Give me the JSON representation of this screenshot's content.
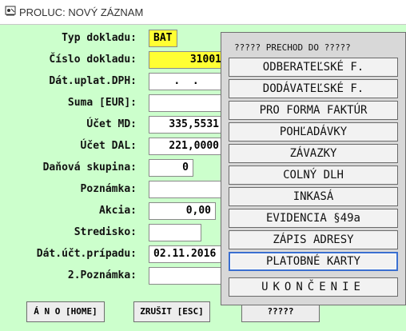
{
  "window": {
    "title": "PROLUC: NOVÝ ZÁZNAM"
  },
  "form": {
    "typ_dokladu": {
      "label": "Typ dokladu:",
      "value": "BAT"
    },
    "cislo_dokladu": {
      "label": "Číslo dokladu:",
      "value": "31001"
    },
    "dat_uplat_dph": {
      "label": "Dát.uplat.DPH:",
      "value": ".  ."
    },
    "suma": {
      "label": "Suma [EUR]:",
      "value": ""
    },
    "ucet_md": {
      "label": "Účet MD:",
      "value": "335,5531"
    },
    "ucet_dal": {
      "label": "Účet DAL:",
      "value": "221,0000"
    },
    "danova_skupina": {
      "label": "Daňová skupina:",
      "value": "0"
    },
    "poznamka": {
      "label": "Poznámka:",
      "value": ""
    },
    "akcia": {
      "label": "Akcia:",
      "value": "0,00"
    },
    "stredisko": {
      "label": "Stredisko:",
      "value": ""
    },
    "dat_uct_pripadu": {
      "label": "Dát.účt.prípadu:",
      "value": "02.11.2016"
    },
    "poznamka2": {
      "label": "2.Poznámka:",
      "value": ""
    }
  },
  "buttons": {
    "ano": "Á N O [HOME]",
    "zrusit": "ZRUŠIT [ESC]",
    "qqq": "?????"
  },
  "popup": {
    "title": "?????  PRECHOD DO  ?????",
    "items": [
      "ODBERATEĽSKÉ F.",
      "DODÁVATEĽSKÉ F.",
      "PRO FORMA FAKTÚR",
      "POHĽADÁVKY",
      "ZÁVAZKY",
      "COLNÝ DLH",
      "INKASÁ",
      "EVIDENCIA §49a",
      "ZÁPIS ADRESY",
      "PLATOBNÉ KARTY",
      "UKONČENIE"
    ]
  }
}
